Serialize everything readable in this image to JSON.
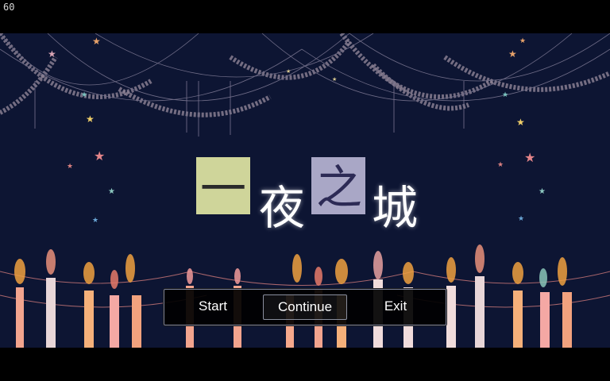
{
  "fps_counter": "60",
  "title": {
    "chars": [
      "一",
      "夜",
      "之",
      "城"
    ]
  },
  "menu": {
    "items": [
      {
        "label": "Start",
        "selected": false
      },
      {
        "label": "Continue",
        "selected": true
      },
      {
        "label": "Exit",
        "selected": false
      }
    ]
  },
  "colors": {
    "background": "#0d1533",
    "title_box_1": "#cfd59a",
    "title_box_2": "#a9a7c6",
    "menu_bg": "#000000"
  }
}
